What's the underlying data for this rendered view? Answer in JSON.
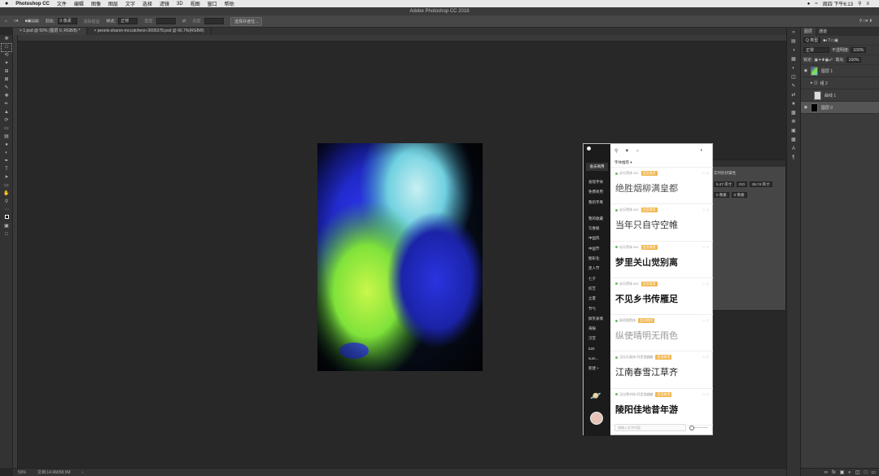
{
  "menubar": {
    "apple": "",
    "items": [
      "Photoshop CC",
      "文件",
      "编辑",
      "图像",
      "图层",
      "文字",
      "选择",
      "滤镜",
      "3D",
      "视图",
      "窗口",
      "帮助"
    ],
    "clock": "周四 下午6:13"
  },
  "window": {
    "title": "Adobe Photoshop CC 2018"
  },
  "options": {
    "feather_label": "羽化:",
    "feather_value": "0 像素",
    "antialias": "消除锯齿",
    "style_label": "样式:",
    "style_value": "正常",
    "width_label": "宽度:",
    "height_label": "高度:",
    "select_mask": "选择并遮住..."
  },
  "tabs": [
    {
      "label": "1.psd @ 50% (图层 0, RGB/8) *"
    },
    {
      "label": "pexels-sharon-mccutcheon-3695378.psd @ 66.7%(RGB/8)"
    }
  ],
  "status": {
    "zoom": "50%",
    "doc": "文档:14.6M/68.5M"
  },
  "layers_panel": {
    "tabs": [
      "图层",
      "通道"
    ],
    "kind": "Q 类型",
    "mode": "正常",
    "opacity_label": "不透明度:",
    "opacity": "100%",
    "lock_label": "锁定:",
    "fill_label": "填充:",
    "fill": "100%",
    "layers": [
      {
        "name": "图层 1",
        "selected": false
      },
      {
        "name": "组 2",
        "selected": false
      },
      {
        "name": "曲线 1",
        "selected": false
      },
      {
        "name": "图层 0",
        "selected": true
      }
    ]
  },
  "properties_panel": {
    "title": "实时形状属性",
    "w": "5.47 英寸",
    "go": "GO",
    "h": "36.74 英寸",
    "x": "0 像素",
    "y": "0 像素"
  },
  "font_panel": {
    "vip": "会员商用",
    "nav": [
      "发现字体",
      "免费商用",
      "我的字库"
    ],
    "nav2": [
      "我的收藏",
      "写春联",
      "中国风",
      "中国节",
      "图形化",
      "黑人节",
      "七夕",
      "综艺",
      "立夏",
      "节气",
      "搞笑表情",
      "海报",
      "汉堂",
      "520",
      "sum...",
      "新建 +"
    ],
    "filter": "字体推荐",
    "input_placeholder": "请输入文字内容",
    "fonts": [
      {
        "meta": "必乐黑体 35J",
        "tag": "会员商用",
        "sample": "绝胜烟柳满皇都",
        "weight": "300",
        "color": "#555555"
      },
      {
        "meta": "必乐黑体 45J",
        "tag": "会员商用",
        "sample": "当年只自守空帷",
        "weight": "400",
        "color": "#333333"
      },
      {
        "meta": "必乐黑体 55J",
        "tag": "会员商用",
        "sample": "梦里关山觉别离",
        "weight": "600",
        "color": "#222222"
      },
      {
        "meta": "必乐黑体 65J",
        "tag": "会员商用",
        "sample": "不见乡书传雁足",
        "weight": "700",
        "color": "#111111"
      },
      {
        "meta": "佩奇细黑体",
        "tag": "会员商用",
        "sample": "纵使晴明无雨色",
        "weight": "200",
        "color": "#999999"
      },
      {
        "meta": "汉仪天真体-阿里里翩翩",
        "tag": "会员商用",
        "sample": "江南春雪江草齐",
        "weight": "400",
        "color": "#222222"
      },
      {
        "meta": "汉仪锦书体-阿里里翩翩",
        "tag": "会员商用",
        "sample": "陵阳佳地昔年游",
        "weight": "700",
        "color": "#111111"
      }
    ]
  },
  "colors": {
    "accent_tag": "#f0b64f",
    "panel_dark": "#1b1b1b",
    "workspace": "#282828"
  }
}
